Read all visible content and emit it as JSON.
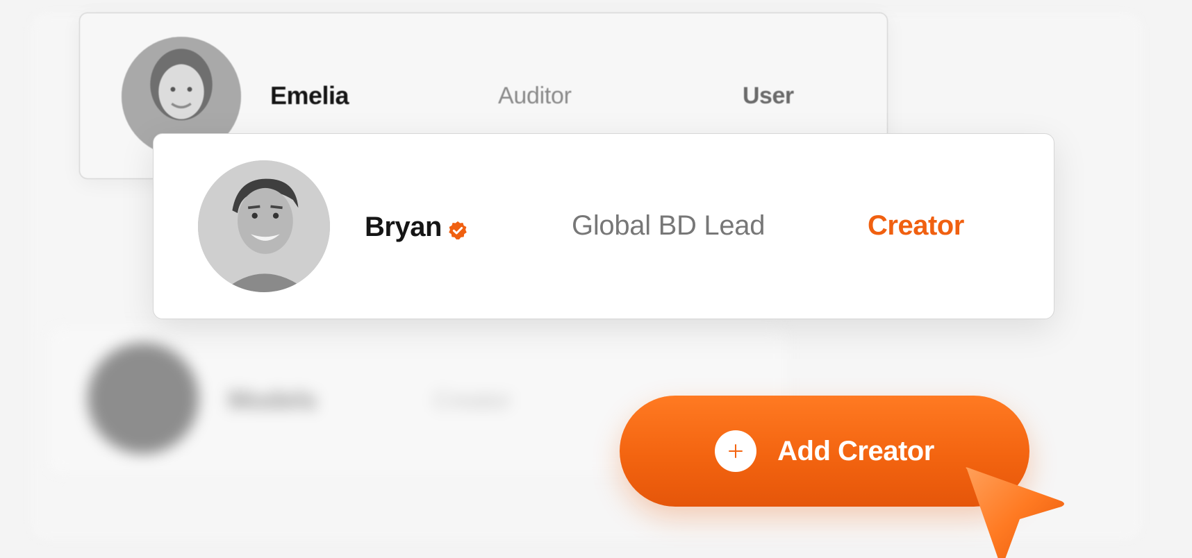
{
  "rows": {
    "emelia": {
      "name": "Emelia",
      "role": "Auditor",
      "badge": "User"
    },
    "bryan": {
      "name": "Bryan",
      "role": "Global BD Lead",
      "badge": "Creator",
      "verified_icon": "verified-badge-icon"
    },
    "blurred": {
      "name": "Models",
      "role": "Creator"
    }
  },
  "actions": {
    "add_creator_label": "Add Creator",
    "add_icon": "plus-icon"
  },
  "colors": {
    "accent": "#f36410",
    "accent_light": "#ff7a22",
    "text_dark": "#151515",
    "text_muted": "#7a7a7a"
  },
  "icons": {
    "pointer": "cursor-arrow-icon"
  }
}
